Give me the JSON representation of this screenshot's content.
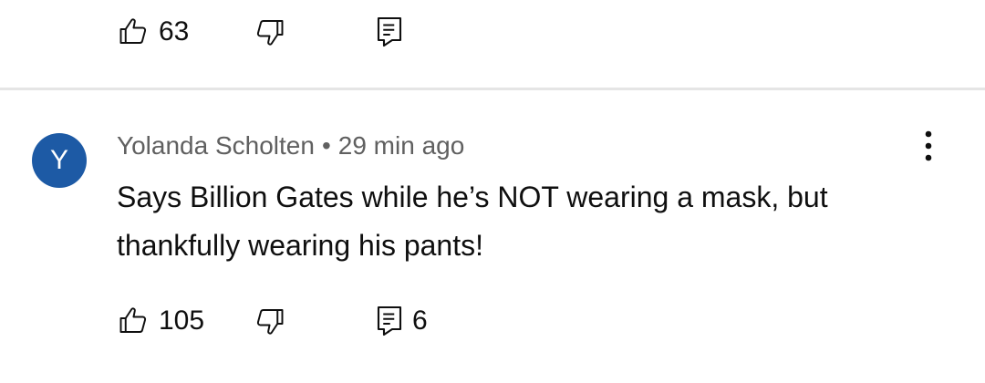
{
  "previous_comment": {
    "like_count": "63",
    "icons": {
      "like": "thumbs-up-icon",
      "dislike": "thumbs-down-icon",
      "reply": "reply-comment-icon"
    }
  },
  "comment": {
    "avatar_initial": "Y",
    "avatar_color": "#1d5aa5",
    "author": "Yolanda Scholten",
    "separator": "•",
    "time": "29 min ago",
    "text": "Says Billion Gates while he’s NOT wearing a mask, but thankfully wearing his pants!",
    "like_count": "105",
    "reply_count": "6",
    "icons": {
      "like": "thumbs-up-icon",
      "dislike": "thumbs-down-icon",
      "reply": "reply-comment-icon",
      "more": "more-vert-icon"
    }
  }
}
